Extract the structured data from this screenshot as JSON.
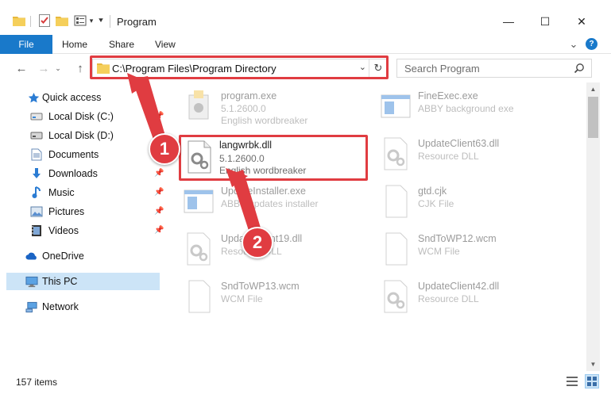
{
  "window": {
    "title": "Program",
    "minimize_glyph": "—",
    "maximize_glyph": "☐",
    "close_glyph": "✕"
  },
  "ribbon": {
    "file_tab": "File",
    "tabs": [
      "Home",
      "Share",
      "View"
    ],
    "expand_glyph": "⌄",
    "help_glyph": "?"
  },
  "nav": {
    "address_path": "C:\\Program Files\\Program Directory",
    "search_placeholder": "Search Program"
  },
  "sidebar": {
    "items": [
      {
        "label": "Quick access",
        "icon": "star-icon",
        "pinned": false
      },
      {
        "label": "Local Disk (C:)",
        "icon": "drive-icon",
        "pinned": true
      },
      {
        "label": "Local Disk (D:)",
        "icon": "drive-icon",
        "pinned": true
      },
      {
        "label": "Documents",
        "icon": "documents-icon",
        "pinned": true
      },
      {
        "label": "Downloads",
        "icon": "download-icon",
        "pinned": true
      },
      {
        "label": "Music",
        "icon": "music-icon",
        "pinned": true
      },
      {
        "label": "Pictures",
        "icon": "pictures-icon",
        "pinned": true
      },
      {
        "label": "Videos",
        "icon": "videos-icon",
        "pinned": true
      },
      {
        "label": "OneDrive",
        "icon": "cloud-icon",
        "pinned": false
      },
      {
        "label": "This PC",
        "icon": "computer-icon",
        "pinned": false,
        "selected": true
      },
      {
        "label": "Network",
        "icon": "network-icon",
        "pinned": false
      }
    ]
  },
  "files": [
    {
      "name": "program.exe",
      "version": "5.1.2600.0",
      "desc": "English wordbreaker",
      "icon": "exe-icon",
      "faded": true
    },
    {
      "name": "FineExec.exe",
      "version": "ABBY background exe",
      "desc": "",
      "icon": "window-icon",
      "faded": true
    },
    {
      "name": "langwrbk.dll",
      "version": "5.1.2600.0",
      "desc": "English wordbreaker",
      "icon": "dll-gear-icon",
      "faded": false
    },
    {
      "name": "UpdateClient63.dll",
      "version": "Resource DLL",
      "desc": "",
      "icon": "dll-gear-icon",
      "faded": true
    },
    {
      "name": "UpdateInstaller.exe",
      "version": "ABBY updates installer",
      "desc": "",
      "icon": "window-icon",
      "faded": true
    },
    {
      "name": "gtd.cjk",
      "version": "CJK File",
      "desc": "",
      "icon": "file-icon",
      "faded": true
    },
    {
      "name": "UpdateClient19.dll",
      "version": "Resource DLL",
      "desc": "",
      "icon": "dll-gear-icon",
      "faded": true
    },
    {
      "name": "SndToWP12.wcm",
      "version": "WCM File",
      "desc": "",
      "icon": "file-icon",
      "faded": true
    },
    {
      "name": "SndToWP13.wcm",
      "version": "WCM File",
      "desc": "",
      "icon": "file-icon",
      "faded": true
    },
    {
      "name": "UpdateClient42.dll",
      "version": "Resource DLL",
      "desc": "",
      "icon": "dll-gear-icon",
      "faded": true
    }
  ],
  "status": {
    "item_count": "157 items"
  },
  "annotations": {
    "step1": "1",
    "step2": "2",
    "accent_color": "#e03c41"
  }
}
